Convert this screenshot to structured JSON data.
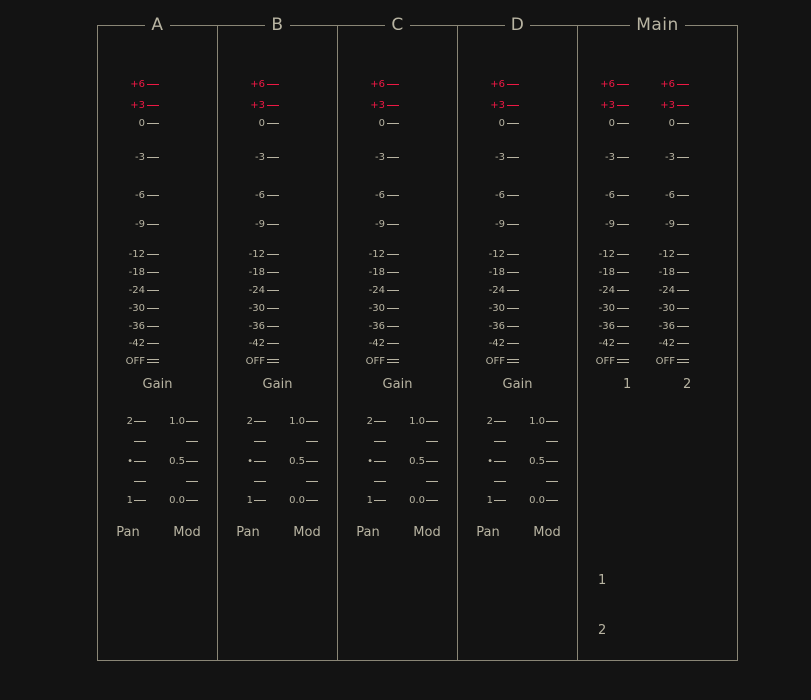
{
  "panels": {
    "A": {
      "title": "A",
      "gain": "Gain",
      "pan": "Pan",
      "mod": "Mod"
    },
    "B": {
      "title": "B",
      "gain": "Gain",
      "pan": "Pan",
      "mod": "Mod"
    },
    "C": {
      "title": "C",
      "gain": "Gain",
      "pan": "Pan",
      "mod": "Mod"
    },
    "D": {
      "title": "D",
      "gain": "Gain",
      "pan": "Pan",
      "mod": "Mod"
    },
    "main": {
      "title": "Main",
      "ch1": "1",
      "ch2": "2",
      "out1": "1",
      "out2": "2"
    }
  },
  "fader_scale": [
    "+6",
    "+3",
    "0",
    "-3",
    "-6",
    "-9",
    "-12",
    "-18",
    "-24",
    "-30",
    "-36",
    "-42",
    "OFF"
  ],
  "pan_scale": [
    "2",
    "",
    "•",
    "",
    "1"
  ],
  "mod_scale": [
    "1.0",
    "",
    "0.5",
    "",
    "0.0"
  ],
  "colors": {
    "background": "#131313",
    "text": "#b8b4a2",
    "border": "#8a8676",
    "over_zero": "#ee1844"
  }
}
